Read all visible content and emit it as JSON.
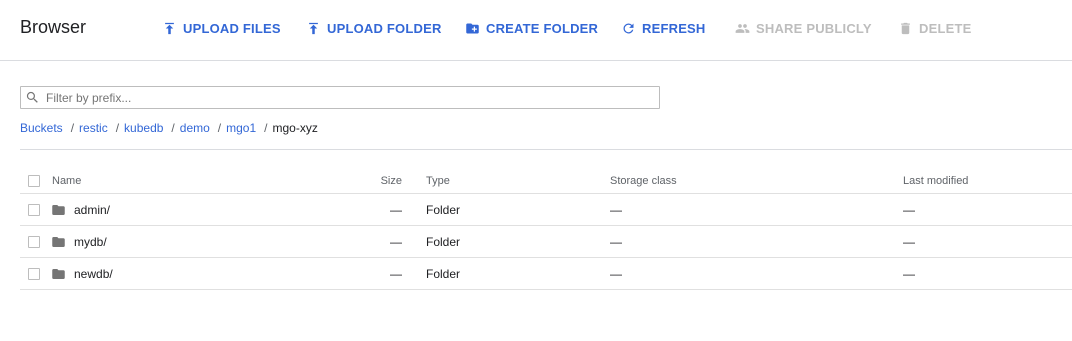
{
  "toolbar": {
    "title": "Browser",
    "buttons": [
      {
        "label": "UPLOAD FILES",
        "icon": "upload-icon",
        "enabled": true
      },
      {
        "label": "UPLOAD FOLDER",
        "icon": "upload-folder-icon",
        "enabled": true
      },
      {
        "label": "CREATE FOLDER",
        "icon": "create-folder-icon",
        "enabled": true
      },
      {
        "label": "REFRESH",
        "icon": "refresh-icon",
        "enabled": true
      },
      {
        "label": "SHARE PUBLICLY",
        "icon": "people-icon",
        "enabled": false
      },
      {
        "label": "DELETE",
        "icon": "trash-icon",
        "enabled": false
      }
    ]
  },
  "filter": {
    "placeholder": "Filter by prefix...",
    "value": ""
  },
  "breadcrumb": {
    "links": [
      "Buckets",
      "restic",
      "kubedb",
      "demo",
      "mgo1"
    ],
    "separator": "/",
    "current": "mgo-xyz"
  },
  "table": {
    "columns": {
      "name": "Name",
      "size": "Size",
      "type": "Type",
      "storage": "Storage class",
      "modified": "Last modified"
    },
    "rows": [
      {
        "name": "admin/",
        "size": "—",
        "type": "Folder",
        "storage": "—",
        "modified": "—"
      },
      {
        "name": "mydb/",
        "size": "—",
        "type": "Folder",
        "storage": "—",
        "modified": "—"
      },
      {
        "name": "newdb/",
        "size": "—",
        "type": "Folder",
        "storage": "—",
        "modified": "—"
      }
    ]
  },
  "colors": {
    "accent": "#3367d6",
    "disabled": "#bdbdbd",
    "divider": "#dadce0",
    "icon": "#757575"
  }
}
